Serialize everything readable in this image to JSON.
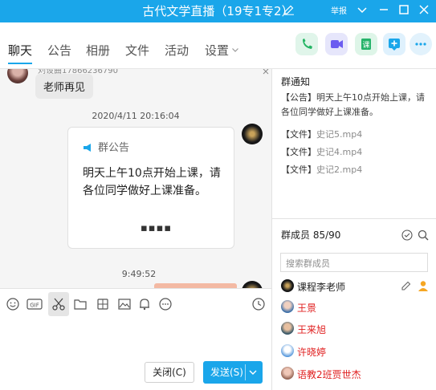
{
  "window": {
    "title": "古代文学直播（19专1专2）",
    "report_label": "举报",
    "accent_color": "#1aa6ea"
  },
  "tabs": [
    {
      "label": "聊天"
    },
    {
      "label": "公告"
    },
    {
      "label": "相册"
    },
    {
      "label": "文件"
    },
    {
      "label": "活动"
    },
    {
      "label": "设置"
    }
  ],
  "chat": {
    "prev_bubble": "老师再见",
    "prev_sender_partial": "刘设曲17866236790",
    "timestamp1": "2020/4/11 20:16:04",
    "announcement": {
      "header": "群公告",
      "body": "明天上午10点开始上课，请各位同学做好上课准备。",
      "ellipsis": "▪▪▪▪"
    },
    "timestamp2": "9:49:52"
  },
  "composer": {
    "close_label": "关闭(C)",
    "send_label": "发送(S)"
  },
  "notice": {
    "title": "群通知",
    "announcement_label": "【公告】",
    "announcement_text": "明天上午10点开始上课，请各位同学做好上课准备。",
    "files": [
      {
        "label": "【文件】",
        "name": "史记5.mp4"
      },
      {
        "label": "【文件】",
        "name": "史记4.mp4"
      },
      {
        "label": "【文件】",
        "name": "史记2.mp4"
      }
    ]
  },
  "members": {
    "title": "群成员 85/90",
    "search_placeholder": "搜索群成员",
    "list": [
      {
        "name": "课程李老师",
        "color": "#222222"
      },
      {
        "name": "王景",
        "color": "#e02020"
      },
      {
        "name": "王来旭",
        "color": "#e02020"
      },
      {
        "name": "许晓婷",
        "color": "#e02020"
      },
      {
        "name": "语教2班贾世杰",
        "color": "#e02020"
      }
    ]
  }
}
